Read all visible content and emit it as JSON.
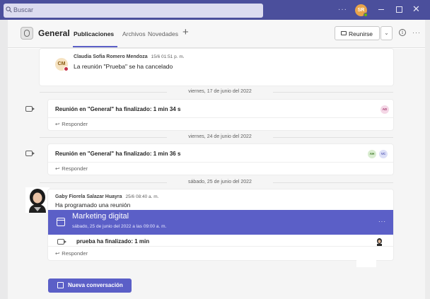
{
  "titlebar": {
    "search_placeholder": "Buscar",
    "more": "···",
    "avatar_initials": "SR"
  },
  "channel": {
    "name": "General",
    "tabs": [
      {
        "label": "Publicaciones",
        "active": true
      },
      {
        "label": "Archivos",
        "active": false
      },
      {
        "label": "Novedades",
        "active": false
      }
    ],
    "meet_button": "Reunirse",
    "info": "i",
    "more": "···"
  },
  "feed": {
    "cancel_post": {
      "author_initials": "CM",
      "author": "Claudia Sofia Romero Mendoza",
      "time": "15/6 01:51 p. m.",
      "text": "La reunión \"Prueba\" se ha cancelado"
    },
    "date_1": "viernes, 17 de junio del 2022",
    "meeting_1": {
      "text": "Reunión en \"General\" ha finalizado: 1 min 34 s",
      "participants": [
        "AD"
      ]
    },
    "date_2": "viernes, 24 de junio del 2022",
    "meeting_2": {
      "text": "Reunión en \"General\" ha finalizado: 1 min 36 s",
      "participants": [
        "AH",
        "VC"
      ]
    },
    "date_3": "sábado, 25 de junio del 2022",
    "scheduled_post": {
      "author": "Gaby Fiorela Salazar Huayra",
      "time": "25/6 08:40 a. m.",
      "text": "Ha programado una reunión",
      "meeting_title": "Marketing digital",
      "meeting_date": "sábado, 25 de junio del 2022 a las 09:00 a. m.",
      "meeting_more": "···",
      "ended_text": "prueba ha finalizado: 1 min"
    },
    "reply_label": "Responder",
    "new_conversation": "Nueva conversación"
  },
  "colors": {
    "titlebar": "#4b4f9c",
    "brand": "#5b5fc7",
    "feed_bg": "#f5f5f5"
  }
}
